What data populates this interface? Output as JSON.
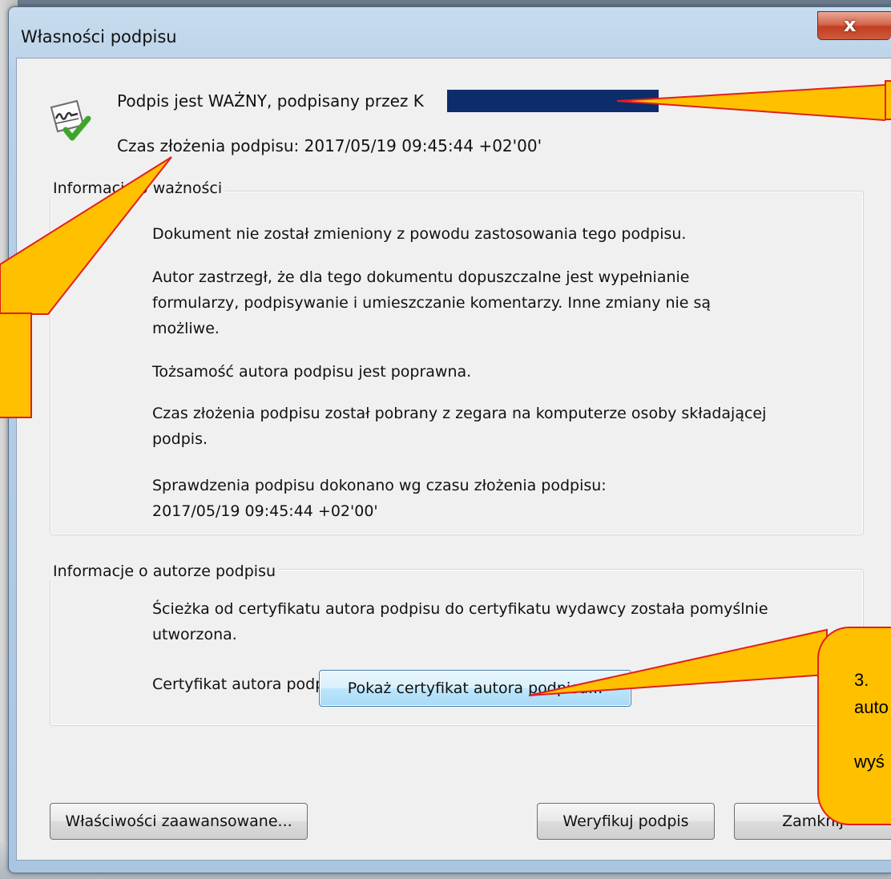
{
  "window": {
    "title": "Własności podpisu",
    "close_label": "x"
  },
  "header": {
    "line1": "Podpis jest WAŻNY, podpisany przez K",
    "line2": "Czas złożenia podpisu:  2017/05/19 09:45:44 +02'00'"
  },
  "validity_group": {
    "title": "Informacje o ważności",
    "paragraphs": [
      "Dokument nie został zmieniony z powodu zastosowania tego podpisu.",
      "Autor zastrzegł, że dla tego dokumentu dopuszczalne jest wypełnianie\nformularzy, podpisywanie i umieszczanie komentarzy. Inne zmiany nie są\nmożliwe.",
      "Tożsamość autora podpisu jest poprawna.",
      "Czas złożenia podpisu został pobrany z zegara na komputerze osoby składającej\npodpis.",
      "Sprawdzenia podpisu dokonano wg czasu złożenia podpisu:\n2017/05/19 09:45:44 +02'00'"
    ]
  },
  "author_group": {
    "title": "Informacje o autorze podpisu",
    "paragraphs": [
      "Ścieżka od certyfikatu autora podpisu do certyfikatu wydawcy została pomyślnie\nutworzona.",
      "Certyfikat autora podpisu jest ważny i nie został unieważniony."
    ],
    "show_cert_button": "Pokaż certyfikat autora podpisu..."
  },
  "footer": {
    "advanced_button": "Właściwości zaawansowane...",
    "verify_button": "Weryfikuj podpis",
    "close_button": "Zamknij"
  },
  "callouts": {
    "callout3_text": "3.\nauto\n\nwyś"
  },
  "colors": {
    "callout_fill": "#ffc000",
    "callout_border": "#e02020",
    "redaction": "#0c2c6c"
  }
}
